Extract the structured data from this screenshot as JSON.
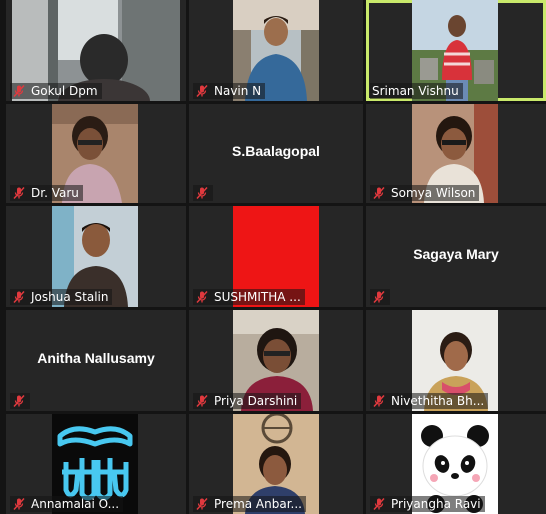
{
  "meeting": {
    "view": "gallery",
    "accent_color": "#c9e96b",
    "muted_icon_color": "#e0393e",
    "participants": [
      {
        "name": "Gokul Dpm",
        "video": "webcam"
      },
      {
        "name": "Navin N",
        "video": "webcam"
      },
      {
        "name": "Sriman Vishnu",
        "video": "webcam",
        "active_speaker": true
      },
      {
        "name": "Dr. Varu",
        "video": "webcam"
      },
      {
        "name": "S.Baalagopal",
        "video": "off"
      },
      {
        "name": "Somya Wilson",
        "video": "webcam"
      },
      {
        "name": "Joshua Stalin",
        "video": "webcam"
      },
      {
        "name": "SUSHMITHA ...",
        "video": "red"
      },
      {
        "name": "Sagaya Mary",
        "video": "off"
      },
      {
        "name": "Anitha Nallusamy",
        "video": "off"
      },
      {
        "name": "Priya Darshini",
        "video": "webcam"
      },
      {
        "name": "Nivethitha Bh...",
        "video": "webcam"
      },
      {
        "name": "Annamalai O...",
        "video": "logo"
      },
      {
        "name": "Prema Anbar...",
        "video": "webcam"
      },
      {
        "name": "Priyangha Ravi",
        "video": "avatar"
      }
    ]
  }
}
